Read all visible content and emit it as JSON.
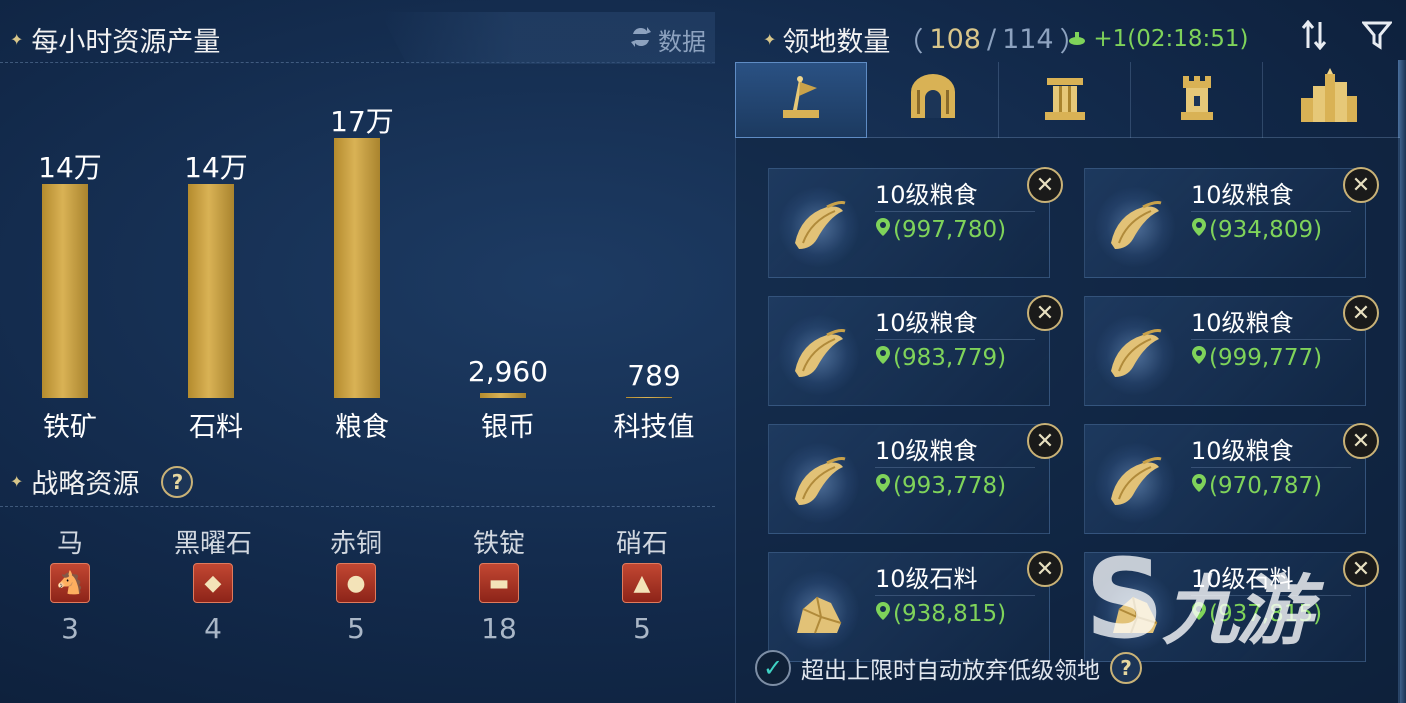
{
  "header": {
    "production_title": "每小时资源产量",
    "data_label": "数据",
    "territory_label": "领地数量",
    "territory_open": "（",
    "territory_current": "108",
    "territory_slash": "/",
    "territory_max": "114",
    "territory_close": "）",
    "territory_gain": "+1(02:18:51)"
  },
  "chart_data": {
    "type": "bar",
    "categories": [
      "铁矿",
      "石料",
      "粮食",
      "银币",
      "科技值"
    ],
    "values": [
      140000,
      140000,
      170000,
      2960,
      789
    ],
    "value_labels": [
      "14万",
      "14万",
      "17万",
      "2,960",
      "789"
    ],
    "ylim": [
      0,
      170000
    ]
  },
  "strategic": {
    "title": "战略资源",
    "help": "?",
    "items": [
      {
        "name": "马",
        "icon": "horse-icon",
        "count": "3"
      },
      {
        "name": "黑曜石",
        "icon": "obsidian-icon",
        "count": "4"
      },
      {
        "name": "赤铜",
        "icon": "copper-icon",
        "count": "5"
      },
      {
        "name": "铁锭",
        "icon": "iron-ingot-icon",
        "count": "18"
      },
      {
        "name": "硝石",
        "icon": "saltpeter-icon",
        "count": "5"
      }
    ]
  },
  "tabs": [
    {
      "icon": "territory-flag-icon",
      "active": true
    },
    {
      "icon": "city-gate-icon",
      "active": false
    },
    {
      "icon": "pillar-icon",
      "active": false
    },
    {
      "icon": "tower-icon",
      "active": false
    },
    {
      "icon": "city-skyline-icon",
      "active": false
    }
  ],
  "territories": [
    {
      "title": "10级粮食",
      "coord": "(997,780)",
      "type": "grain"
    },
    {
      "title": "10级粮食",
      "coord": "(934,809)",
      "type": "grain"
    },
    {
      "title": "10级粮食",
      "coord": "(983,779)",
      "type": "grain"
    },
    {
      "title": "10级粮食",
      "coord": "(999,777)",
      "type": "grain"
    },
    {
      "title": "10级粮食",
      "coord": "(993,778)",
      "type": "grain"
    },
    {
      "title": "10级粮食",
      "coord": "(970,787)",
      "type": "grain"
    },
    {
      "title": "10级石料",
      "coord": "(938,815)",
      "type": "stone"
    },
    {
      "title": "10级石料",
      "coord": "(937,815)",
      "type": "stone"
    }
  ],
  "close_glyph": "✕",
  "auto_abandon": {
    "label": "超出上限时自动放弃低级领地",
    "checked": true,
    "check_glyph": "✓",
    "help": "?"
  },
  "watermark": "九游",
  "colors": {
    "gold_bar": "#d9b255",
    "coord_green": "#7fd35a",
    "accent_gold": "#c9b277"
  }
}
